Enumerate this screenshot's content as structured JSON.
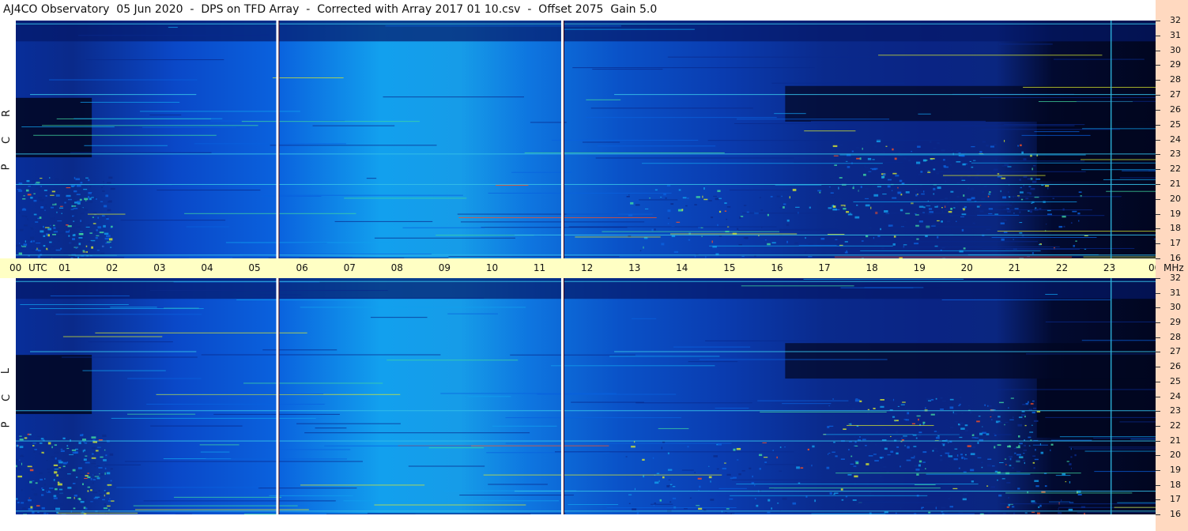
{
  "title": "AJ4CO Observatory  05 Jun 2020  -  DPS on TFD Array  -  Corrected with Array 2017 01 10.csv  -  Offset 2075  Gain 5.0",
  "chart_data": [
    {
      "type": "heatmap",
      "name": "RCP",
      "polarization_letters": [
        "R",
        "C",
        "P"
      ],
      "x_axis": {
        "unit": "UTC",
        "range": [
          0,
          24
        ]
      },
      "y_axis": {
        "unit": "MHz",
        "range": [
          16,
          32
        ],
        "ticks": [
          32,
          31,
          30,
          29,
          28,
          27,
          26,
          25,
          24,
          23,
          22,
          21,
          20,
          19,
          18,
          17,
          16
        ]
      },
      "calibration_lines_utc": [
        5.5,
        11.5
      ],
      "colormap": [
        "#010620",
        "#0a2a8c",
        "#0a62de",
        "#12a0ee",
        "#40d8a0",
        "#d8e830",
        "#ff5020"
      ]
    },
    {
      "type": "heatmap",
      "name": "LCP",
      "polarization_letters": [
        "L",
        "C",
        "P"
      ],
      "x_axis": {
        "unit": "UTC",
        "range": [
          0,
          24
        ]
      },
      "y_axis": {
        "unit": "MHz",
        "range": [
          16,
          32
        ],
        "ticks": [
          32,
          31,
          30,
          29,
          28,
          27,
          26,
          25,
          24,
          23,
          22,
          21,
          20,
          19,
          18,
          17,
          16
        ]
      },
      "calibration_lines_utc": [
        5.5,
        11.5
      ],
      "colormap": [
        "#010620",
        "#0a2a8c",
        "#0a62de",
        "#12a0ee",
        "#40d8a0",
        "#d8e830",
        "#ff5020"
      ]
    }
  ],
  "time_axis": {
    "labels": [
      "00",
      "01",
      "02",
      "03",
      "04",
      "05",
      "06",
      "07",
      "08",
      "09",
      "10",
      "11",
      "12",
      "13",
      "14",
      "15",
      "16",
      "17",
      "18",
      "19",
      "20",
      "21",
      "22",
      "23",
      "00"
    ],
    "utc_label": "UTC",
    "unit_label": "MHz"
  },
  "frequency_labels": [
    "32",
    "31",
    "30",
    "29",
    "28",
    "27",
    "26",
    "25",
    "24",
    "23",
    "22",
    "21",
    "20",
    "19",
    "18",
    "17",
    "16"
  ]
}
